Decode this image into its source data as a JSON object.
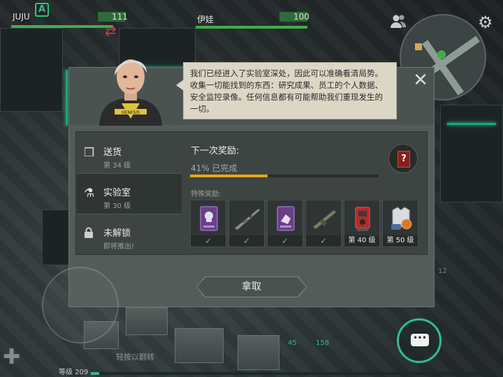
{
  "hud": {
    "player1": {
      "name": "JUJU",
      "badge": "A",
      "value": "111",
      "health_fraction": 0.9
    },
    "player2": {
      "name": "伊娃",
      "value": "100",
      "health_fraction": 1.0
    },
    "social_icon": "people-icon",
    "settings_icon": "gear-icon"
  },
  "dialog": {
    "speech": "我们已经进入了实验室深处，因此可以准确看清局势。收集一切能找到的东西：研究成果、员工的个人数据、安全监控录像。任何信息都有可能帮助我们重现发生的一切。",
    "portrait_jacket_text": "GENESIS",
    "close_icon": "close-icon",
    "categories": [
      {
        "title": "送货",
        "subtitle": "第 34 级",
        "icon": "boxes-icon"
      },
      {
        "title": "实验室",
        "subtitle": "第 30 级",
        "icon": "flask-icon"
      },
      {
        "title": "未解锁",
        "subtitle": "即将推出!",
        "icon": "lock-icon"
      }
    ],
    "next_reward_label": "下一次奖励:",
    "progress_text": "41% 已完成",
    "progress_fraction": 0.41,
    "special_label": "特殊奖励:",
    "next_reward_icon": "mystery-card-icon",
    "rewards": [
      {
        "icon": "skull-card-icon",
        "footer": "✓"
      },
      {
        "icon": "sniper-rifle-icon",
        "footer": "✓"
      },
      {
        "icon": "hand-card-icon",
        "footer": "✓"
      },
      {
        "icon": "assault-rifle-icon",
        "footer": "✓"
      },
      {
        "icon": "red-machine-icon",
        "footer": "第 40 级"
      },
      {
        "icon": "armor-vest-icon",
        "footer": "第 50 级"
      }
    ],
    "claim_label": "拿取"
  },
  "bottom": {
    "hint": "轻按以翻转",
    "level": "等级 209",
    "count_a": "45",
    "count_b": "158",
    "faint_number": "12",
    "chat_icon": "chat-icon"
  },
  "colors": {
    "accent_green": "#3fae4f",
    "progress_yellow": "#e2a81e",
    "teal": "#2fbf8f"
  }
}
